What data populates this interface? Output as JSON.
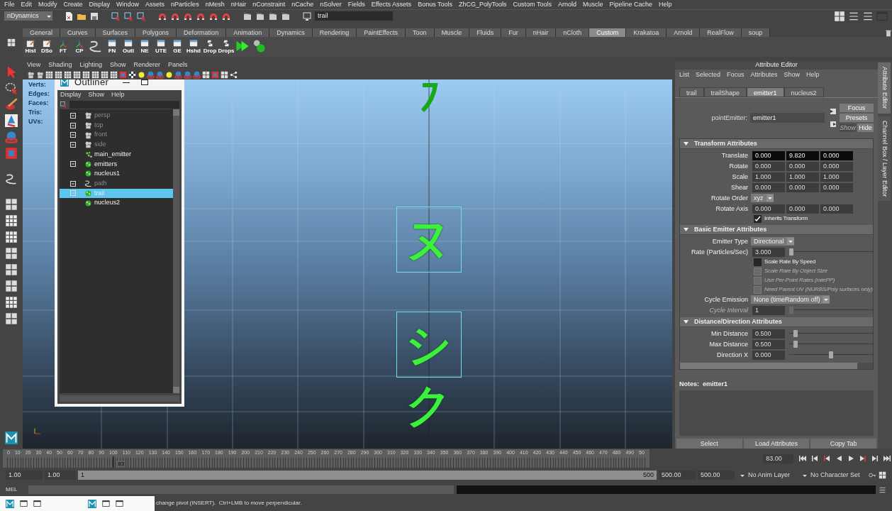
{
  "menu_bar": [
    "File",
    "Edit",
    "Modify",
    "Create",
    "Display",
    "Window",
    "Assets",
    "nParticles",
    "nMesh",
    "nHair",
    "nConstraint",
    "nCache",
    "nSolver",
    "Fields",
    "Effects Assets",
    "Bonus Tools",
    "ZhCG_PolyTools",
    "Custom Tools",
    "Arnold",
    "Muscle",
    "Pipeline Cache",
    "Help"
  ],
  "toolbar": {
    "mode": "nDynamics",
    "search_value": "trail"
  },
  "shelf": {
    "tabs": [
      {
        "label": "General",
        "selected": false
      },
      {
        "label": "Curves",
        "selected": false
      },
      {
        "label": "Surfaces",
        "selected": false
      },
      {
        "label": "Polygons",
        "selected": false
      },
      {
        "label": "Deformation",
        "selected": false
      },
      {
        "label": "Animation",
        "selected": false
      },
      {
        "label": "Dynamics",
        "selected": false
      },
      {
        "label": "Rendering",
        "selected": false
      },
      {
        "label": "PaintEffects",
        "selected": false
      },
      {
        "label": "Toon",
        "selected": false
      },
      {
        "label": "Muscle",
        "selected": false
      },
      {
        "label": "Fluids",
        "selected": false
      },
      {
        "label": "Fur",
        "selected": false
      },
      {
        "label": "nHair",
        "selected": false
      },
      {
        "label": "nCloth",
        "selected": false
      },
      {
        "label": "Custom",
        "selected": true
      },
      {
        "label": "Krakatoa",
        "selected": false
      },
      {
        "label": "Arnold",
        "selected": false
      },
      {
        "label": "RealFlow",
        "selected": false
      },
      {
        "label": "soup",
        "selected": false
      }
    ],
    "items": [
      {
        "kind": "pencil",
        "label": "Hist"
      },
      {
        "kind": "pencil",
        "label": "DSo"
      },
      {
        "kind": "axes",
        "label": "FT"
      },
      {
        "kind": "axes",
        "label": "CP"
      },
      {
        "kind": "curve"
      },
      {
        "kind": "window",
        "label": "FN"
      },
      {
        "kind": "window",
        "label": "Outl"
      },
      {
        "kind": "window",
        "label": "NE"
      },
      {
        "kind": "window",
        "label": "UTE"
      },
      {
        "kind": "window",
        "label": "GE"
      },
      {
        "kind": "window",
        "label": "Hshd"
      },
      {
        "kind": "python",
        "label": "Drop"
      },
      {
        "kind": "python",
        "label": "Drops"
      },
      {
        "kind": "play"
      },
      {
        "kind": "solver"
      }
    ]
  },
  "viewport": {
    "menu": [
      "View",
      "Shading",
      "Lighting",
      "Show",
      "Renderer",
      "Panels"
    ],
    "hud": [
      "Verts:",
      "Edges:",
      "Faces:",
      "Tris:",
      "UVs:"
    ],
    "objects": [
      {
        "kind": "fragment"
      },
      {
        "kind": "glyph",
        "text": "ヌ",
        "framed": true
      },
      {
        "kind": "glyph",
        "text": "シ",
        "framed": true
      },
      {
        "kind": "glyph",
        "text": "ク",
        "framed": false
      }
    ]
  },
  "outliner": {
    "title": "Outliner",
    "menu": [
      "Display",
      "Show",
      "Help"
    ],
    "items": [
      {
        "label": "persp",
        "kind": "camera",
        "expandable": true,
        "dimmed": true,
        "selected": false
      },
      {
        "label": "top",
        "kind": "camera",
        "expandable": true,
        "dimmed": true,
        "selected": false
      },
      {
        "label": "front",
        "kind": "camera",
        "expandable": true,
        "dimmed": true,
        "selected": false
      },
      {
        "label": "side",
        "kind": "camera",
        "expandable": true,
        "dimmed": true,
        "selected": false
      },
      {
        "label": "main_emitter",
        "kind": "emitter",
        "expandable": false,
        "dimmed": false,
        "selected": false
      },
      {
        "label": "emitters",
        "kind": "particle",
        "expandable": true,
        "dimmed": false,
        "selected": false
      },
      {
        "label": "nucleus1",
        "kind": "particle",
        "expandable": false,
        "dimmed": false,
        "selected": false
      },
      {
        "label": "path",
        "kind": "curve",
        "expandable": true,
        "dimmed": true,
        "selected": false
      },
      {
        "label": "trail",
        "kind": "particle",
        "expandable": true,
        "dimmed": false,
        "selected": true
      },
      {
        "label": "nucleus2",
        "kind": "particle",
        "expandable": false,
        "dimmed": false,
        "selected": false
      }
    ]
  },
  "attribute_editor": {
    "title": "Attribute Editor",
    "menu": [
      "List",
      "Selected",
      "Focus",
      "Attributes",
      "Show",
      "Help"
    ],
    "tabs": [
      {
        "label": "trail",
        "selected": false
      },
      {
        "label": "trailShape",
        "selected": false
      },
      {
        "label": "emitter1",
        "selected": true
      },
      {
        "label": "nucleus2",
        "selected": false
      }
    ],
    "node_type_label": "pointEmitter:",
    "node_name": "emitter1",
    "buttons": [
      {
        "label": "Focus",
        "disabled": false
      },
      {
        "label": "Presets",
        "disabled": false
      },
      {
        "label": "Show",
        "disabled": true
      },
      {
        "label": "Hide",
        "disabled": false
      }
    ],
    "sections": [
      {
        "title": "Transform Attributes",
        "expanded": true,
        "rows": [
          {
            "kind": "vector",
            "label": "Translate",
            "values": [
              "0.000",
              "9.820",
              "0.000"
            ],
            "active": true
          },
          {
            "kind": "vector",
            "label": "Rotate",
            "values": [
              "0.000",
              "0.000",
              "0.000"
            ],
            "active": false
          },
          {
            "kind": "vector",
            "label": "Scale",
            "values": [
              "1.000",
              "1.000",
              "1.000"
            ],
            "active": false
          },
          {
            "kind": "vector",
            "label": "Shear",
            "values": [
              "0.000",
              "0.000",
              "0.000"
            ],
            "active": false
          },
          {
            "kind": "enum",
            "label": "Rotate Order",
            "value": "xyz",
            "disabled": false
          },
          {
            "kind": "vector",
            "label": "Rotate Axis",
            "values": [
              "0.000",
              "0.000",
              "0.000"
            ],
            "active": false
          },
          {
            "kind": "checkbox",
            "label": "Inherits Transform",
            "checked": true,
            "disabled": false
          }
        ]
      },
      {
        "title": "Basic Emitter Attributes",
        "expanded": true,
        "rows": [
          {
            "kind": "enum",
            "label": "Emitter Type",
            "value": "Directional",
            "disabled": false
          },
          {
            "kind": "slider",
            "label": "Rate (Particles/Sec)",
            "value": "3.000",
            "level": 0.0,
            "disabled": false
          },
          {
            "kind": "checkbox",
            "label": "Scale Rate By Speed",
            "checked": false,
            "disabled": false
          },
          {
            "kind": "checkbox",
            "label": "Scale Rate By Object Size",
            "checked": false,
            "disabled": true
          },
          {
            "kind": "checkbox",
            "label": "Use Per-Point Rates (ratePP)",
            "checked": false,
            "disabled": true
          },
          {
            "kind": "checkbox",
            "label": "Need Parent UV (NURBS/Poly surfaces only)",
            "checked": false,
            "disabled": true
          },
          {
            "kind": "enum",
            "label": "Cycle Emission",
            "value": "None (timeRandom off)",
            "disabled": false
          },
          {
            "kind": "slider",
            "label": "Cycle Interval",
            "value": "1",
            "level": 0.0,
            "disabled": true
          }
        ]
      },
      {
        "title": "Distance/Direction Attributes",
        "expanded": true,
        "rows": [
          {
            "kind": "slider",
            "label": "Min Distance",
            "value": "0.500",
            "level": 0.05,
            "disabled": false
          },
          {
            "kind": "slider",
            "label": "Max Distance",
            "value": "0.500",
            "level": 0.05,
            "disabled": false
          },
          {
            "kind": "slider",
            "label": "Direction X",
            "value": "0.000",
            "level": 0.5,
            "disabled": false
          }
        ]
      }
    ],
    "notes_label": "Notes:  emitter1",
    "footer_buttons": [
      "Select",
      "Load Attributes",
      "Copy Tab"
    ],
    "side_tabs": [
      {
        "label": "Attribute Editor",
        "selected": true
      },
      {
        "label": "Channel Box / Layer Editor",
        "selected": false
      }
    ]
  },
  "timeline": {
    "ticks": [
      "0",
      "10",
      "20",
      "30",
      "40",
      "50",
      "60",
      "70",
      "80",
      "90",
      "100",
      "110",
      "120",
      "130",
      "140",
      "150",
      "160",
      "170",
      "180",
      "190",
      "200",
      "210",
      "220",
      "230",
      "240",
      "250",
      "260",
      "270",
      "280",
      "290",
      "300",
      "310",
      "320",
      "330",
      "340",
      "350",
      "360",
      "370",
      "380",
      "390",
      "400",
      "410",
      "420",
      "430",
      "440",
      "450",
      "460",
      "470",
      "480",
      "490",
      "50"
    ],
    "current_frame": "83",
    "level": 0.166,
    "frame_field": "83.00"
  },
  "range": {
    "level": 1.0,
    "start": "1.00",
    "start_inner": "1.00",
    "slider_start": "1",
    "slider_end": "500",
    "end_inner": "500.00",
    "end": "500.00",
    "anim_layer": "No Anim Layer",
    "character_set": "No Character Set"
  },
  "command_line": {
    "label": "MEL"
  },
  "help_line": "change pivot (INSERT).  Ctrl+LMB to move perpendicular."
}
